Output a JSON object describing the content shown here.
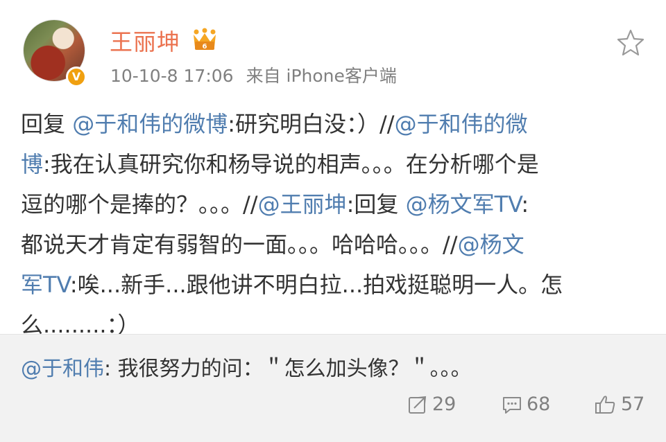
{
  "header": {
    "username": "王丽坤",
    "vip_icon": "crown-vip-icon",
    "verified_badge": "V",
    "timestamp": "10-10-8 17:06",
    "source": "来自 iPhone客户端",
    "favorite_icon": "star-icon"
  },
  "post": {
    "lines": [
      [
        {
          "t": "回复 ",
          "at": false
        },
        {
          "t": "@于和伟的微博",
          "at": true
        },
        {
          "t": ":研究明白没：）//",
          "at": false
        },
        {
          "t": "@于和伟的微",
          "at": true
        }
      ],
      [
        {
          "t": "博",
          "at": true
        },
        {
          "t": ":我在认真研究你和杨导说的相声。。。在分析哪个是",
          "at": false
        }
      ],
      [
        {
          "t": "逗的哪个是捧的？。。。//",
          "at": false
        },
        {
          "t": "@王丽坤",
          "at": true
        },
        {
          "t": ":回复 ",
          "at": false
        },
        {
          "t": "@杨文军TV",
          "at": true
        },
        {
          "t": ":",
          "at": false
        }
      ],
      [
        {
          "t": "都说天才肯定有弱智的一面。。。哈哈哈。。。//",
          "at": false
        },
        {
          "t": "@杨文",
          "at": true
        }
      ],
      [
        {
          "t": "军TV",
          "at": true
        },
        {
          "t": ":唉...新手...跟他讲不明白拉...拍戏挺聪明一人。怎",
          "at": false
        }
      ],
      [
        {
          "t": "么.........：）",
          "at": false
        }
      ]
    ]
  },
  "repost": {
    "author": "@于和伟",
    "text": ": 我很努力的问：＂怎么加头像？＂。。。",
    "actions": {
      "forward_count": "29",
      "comment_count": "68",
      "like_count": "57"
    }
  },
  "colors": {
    "username": "#eb7350",
    "link": "#507daf",
    "meta": "#808080",
    "repost_bg": "#f2f2f2"
  }
}
